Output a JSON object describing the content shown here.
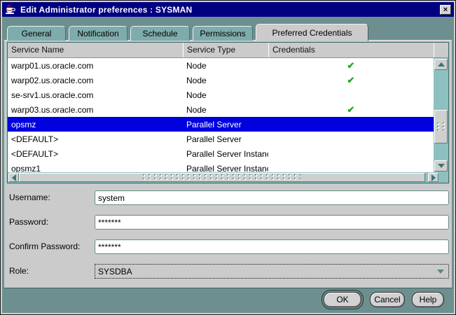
{
  "window": {
    "title": "Edit Administrator preferences : SYSMAN"
  },
  "icons": {
    "close": "×",
    "check": "✔",
    "dropdown_arrow": "▼"
  },
  "tabs": [
    {
      "label": "General",
      "active": false
    },
    {
      "label": "Notification",
      "active": false
    },
    {
      "label": "Schedule",
      "active": false
    },
    {
      "label": "Permissions",
      "active": false
    },
    {
      "label": "Preferred Credentials",
      "active": true
    }
  ],
  "credentials_table": {
    "columns": [
      "Service Name",
      "Service Type",
      "Credentials"
    ],
    "rows": [
      {
        "service_name": "warp01.us.oracle.com",
        "service_type": "Node",
        "credentials": "✔",
        "selected": false
      },
      {
        "service_name": "warp02.us.oracle.com",
        "service_type": "Node",
        "credentials": "✔",
        "selected": false
      },
      {
        "service_name": "se-srv1.us.oracle.com",
        "service_type": "Node",
        "credentials": "",
        "selected": false
      },
      {
        "service_name": "warp03.us.oracle.com",
        "service_type": "Node",
        "credentials": "✔",
        "selected": false
      },
      {
        "service_name": "opsmz",
        "service_type": "Parallel Server",
        "credentials": "",
        "selected": true
      },
      {
        "service_name": "<DEFAULT>",
        "service_type": "Parallel Server",
        "credentials": "",
        "selected": false
      },
      {
        "service_name": "<DEFAULT>",
        "service_type": "Parallel Server Instance",
        "credentials": "",
        "selected": false
      },
      {
        "service_name": "opsmz1",
        "service_type": "Parallel Server Instance",
        "credentials": "",
        "selected": false
      }
    ]
  },
  "form": {
    "username_label": "Username:",
    "username_value": "system",
    "password_label": "Password:",
    "password_value": "*******",
    "confirm_label": "Confirm Password:",
    "confirm_value": "*******",
    "role_label": "Role:",
    "role_value": "SYSDBA"
  },
  "buttons": {
    "ok": "OK",
    "cancel": "Cancel",
    "help": "Help"
  },
  "colors": {
    "titlebar": "#000080",
    "dialog_background": "#6E8F8F",
    "inactive_tab": "#7EACAC",
    "panel_gray": "#CBCBCB",
    "selected_row": "#0000DD",
    "check_green": "#1FA81F",
    "scrollbar_track": "#8FC0C0"
  }
}
